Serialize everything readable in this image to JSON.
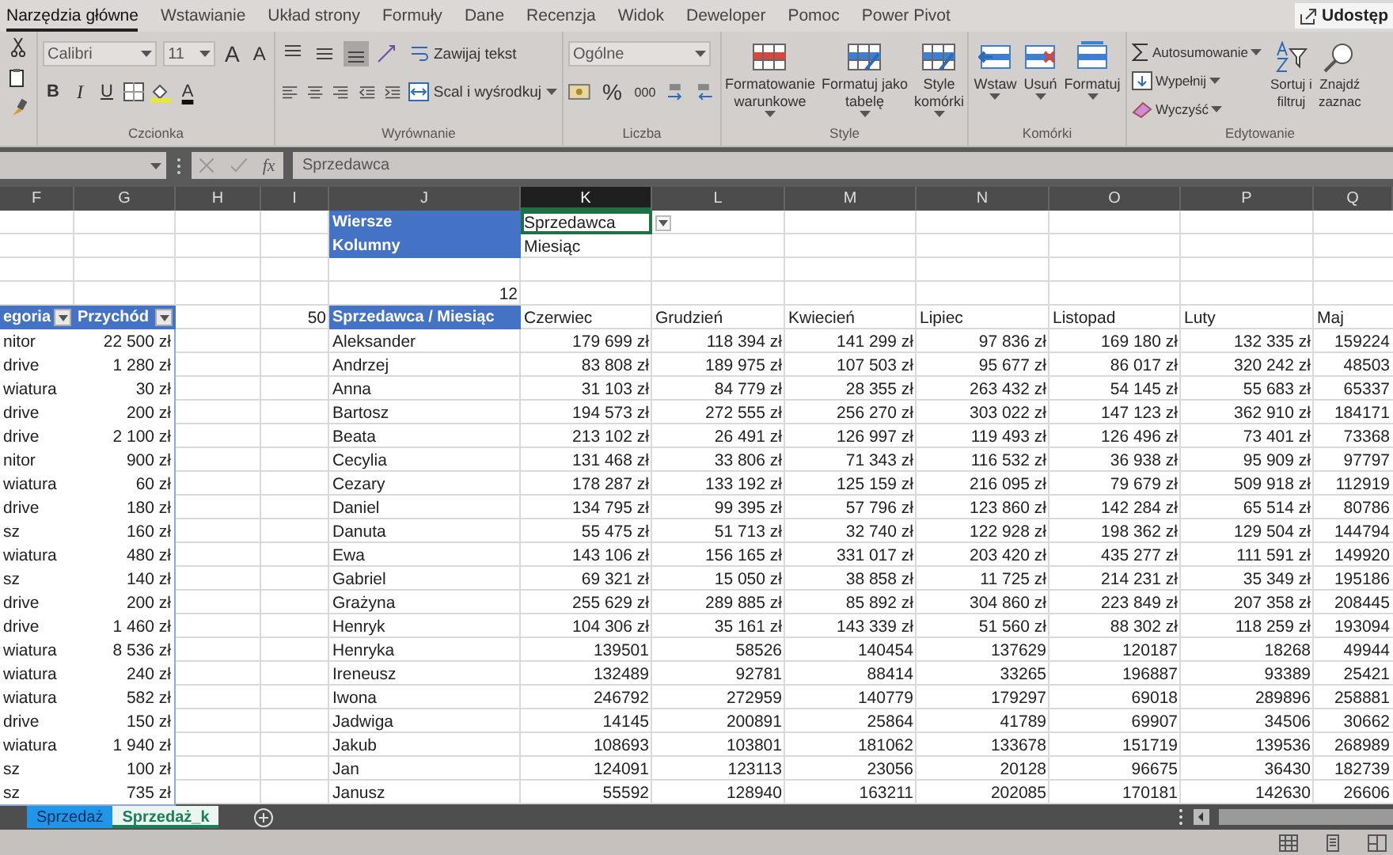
{
  "ribbon": {
    "tabs": [
      {
        "label": "Narzędzia główne",
        "selected": true
      },
      {
        "label": "Wstawianie",
        "selected": false
      },
      {
        "label": "Układ strony",
        "selected": false
      },
      {
        "label": "Formuły",
        "selected": false
      },
      {
        "label": "Dane",
        "selected": false
      },
      {
        "label": "Recenzja",
        "selected": false
      },
      {
        "label": "Widok",
        "selected": false
      },
      {
        "label": "Deweloper",
        "selected": false
      },
      {
        "label": "Pomoc",
        "selected": false
      },
      {
        "label": "Power Pivot",
        "selected": false
      }
    ],
    "share_label": "Udostęp",
    "groups": [
      {
        "kind": "clipboard"
      },
      {
        "kind": "font",
        "label": "Czcionka",
        "font_name": "Calibri",
        "font_size": "11",
        "grow": "A",
        "shrink": "A",
        "bold": "B",
        "italic": "I",
        "underline": "U",
        "font_color": "A"
      },
      {
        "kind": "alignment",
        "label": "Wyrównanie",
        "vertical_align": [
          {
            "selected": false
          },
          {
            "selected": false
          },
          {
            "selected": true
          }
        ],
        "wrap": "Zawijaj tekst",
        "merge": "Scal i wyśrodkuj"
      },
      {
        "kind": "number",
        "label": "Liczba",
        "format": "Ogólne",
        "percent": "%",
        "thousands": "000"
      },
      {
        "kind": "styles",
        "label": "Style",
        "buttons": [
          {
            "lines": [
              "Formatowanie",
              "warunkowe"
            ]
          },
          {
            "lines": [
              "Formatuj jako",
              "tabelę"
            ]
          },
          {
            "lines": [
              "Style",
              "komórki"
            ]
          }
        ]
      },
      {
        "kind": "cells",
        "label": "Komórki",
        "buttons": [
          {
            "lines": [
              "Wstaw"
            ]
          },
          {
            "lines": [
              "Usuń"
            ]
          },
          {
            "lines": [
              "Formatuj"
            ]
          }
        ]
      },
      {
        "kind": "editing",
        "label": "Edytowanie",
        "items": [
          "Autosumowanie",
          "Wypełnij",
          "Wyczyść"
        ],
        "buttons": [
          {
            "lines": [
              "Sortuj i",
              "filtruj"
            ]
          },
          {
            "lines": [
              "Znajdź",
              "zaznac"
            ]
          }
        ]
      }
    ]
  },
  "formula_bar": {
    "function_label": "fx",
    "formula": "Sprzedawca"
  },
  "sheet": {
    "columns": [
      {
        "label": "F",
        "selected": false
      },
      {
        "label": "G",
        "selected": false
      },
      {
        "label": "H",
        "selected": false
      },
      {
        "label": "I",
        "selected": false
      },
      {
        "label": "J",
        "selected": false
      },
      {
        "label": "K",
        "selected": true
      },
      {
        "label": "L",
        "selected": false
      },
      {
        "label": "M",
        "selected": false
      },
      {
        "label": "N",
        "selected": false
      },
      {
        "label": "O",
        "selected": false
      },
      {
        "label": "P",
        "selected": false
      },
      {
        "label": "Q",
        "selected": false
      }
    ],
    "pivot_fields": [
      {
        "label": "Wiersze",
        "value": "Sprzedawca",
        "selected": true
      },
      {
        "label": "Kolumny",
        "value": "Miesiąc",
        "selected": false
      }
    ],
    "month_count": "12",
    "row_count": "50",
    "source_table": {
      "headers": [
        "egoria",
        "Przychód"
      ],
      "rows": [
        [
          "nitor",
          "22 500 zł"
        ],
        [
          "drive",
          "1 280 zł"
        ],
        [
          "wiatura",
          "30 zł"
        ],
        [
          "drive",
          "200 zł"
        ],
        [
          "drive",
          "2 100 zł"
        ],
        [
          "nitor",
          "900 zł"
        ],
        [
          "wiatura",
          "60 zł"
        ],
        [
          "drive",
          "180 zł"
        ],
        [
          "sz",
          "160 zł"
        ],
        [
          "wiatura",
          "480 zł"
        ],
        [
          "sz",
          "140 zł"
        ],
        [
          "drive",
          "200 zł"
        ],
        [
          "drive",
          "1 460 zł"
        ],
        [
          "wiatura",
          "8 536 zł"
        ],
        [
          "wiatura",
          "240 zł"
        ],
        [
          "wiatura",
          "582 zł"
        ],
        [
          "drive",
          "150 zł"
        ],
        [
          "wiatura",
          "1 940 zł"
        ],
        [
          "sz",
          "100 zł"
        ],
        [
          "sz",
          "735 zł"
        ]
      ]
    },
    "pivot": {
      "corner": "Sprzedawca / Miesiąc",
      "months": [
        "Czerwiec",
        "Grudzień",
        "Kwiecień",
        "Lipiec",
        "Listopad",
        "Luty",
        "Maj"
      ],
      "rows": [
        {
          "name": "Aleksander",
          "values": [
            "179 699 zł",
            "118 394 zł",
            "141 299 zł",
            "97 836 zł",
            "169 180 zł",
            "132 335 zł",
            "159224"
          ]
        },
        {
          "name": "Andrzej",
          "values": [
            "83 808 zł",
            "189 975 zł",
            "107 503 zł",
            "95 677 zł",
            "86 017 zł",
            "320 242 zł",
            "48503"
          ]
        },
        {
          "name": "Anna",
          "values": [
            "31 103 zł",
            "84 779 zł",
            "28 355 zł",
            "263 432 zł",
            "54 145 zł",
            "55 683 zł",
            "65337"
          ]
        },
        {
          "name": "Bartosz",
          "values": [
            "194 573 zł",
            "272 555 zł",
            "256 270 zł",
            "303 022 zł",
            "147 123 zł",
            "362 910 zł",
            "184171"
          ]
        },
        {
          "name": "Beata",
          "values": [
            "213 102 zł",
            "26 491 zł",
            "126 997 zł",
            "119 493 zł",
            "126 496 zł",
            "73 401 zł",
            "73368"
          ]
        },
        {
          "name": "Cecylia",
          "values": [
            "131 468 zł",
            "33 806 zł",
            "71 343 zł",
            "116 532 zł",
            "36 938 zł",
            "95 909 zł",
            "97797"
          ]
        },
        {
          "name": "Cezary",
          "values": [
            "178 287 zł",
            "133 192 zł",
            "125 159 zł",
            "216 095 zł",
            "79 679 zł",
            "509 918 zł",
            "112919"
          ]
        },
        {
          "name": "Daniel",
          "values": [
            "134 795 zł",
            "99 395 zł",
            "57 796 zł",
            "123 860 zł",
            "142 284 zł",
            "65 514 zł",
            "80786"
          ]
        },
        {
          "name": "Danuta",
          "values": [
            "55 475 zł",
            "51 713 zł",
            "32 740 zł",
            "122 928 zł",
            "198 362 zł",
            "129 504 zł",
            "144794"
          ]
        },
        {
          "name": "Ewa",
          "values": [
            "143 106 zł",
            "156 165 zł",
            "331 017 zł",
            "203 420 zł",
            "435 277 zł",
            "111 591 zł",
            "149920"
          ]
        },
        {
          "name": "Gabriel",
          "values": [
            "69 321 zł",
            "15 050 zł",
            "38 858 zł",
            "11 725 zł",
            "214 231 zł",
            "35 349 zł",
            "195186"
          ]
        },
        {
          "name": "Grażyna",
          "values": [
            "255 629 zł",
            "289 885 zł",
            "85 892 zł",
            "304 860 zł",
            "223 849 zł",
            "207 358 zł",
            "208445"
          ]
        },
        {
          "name": "Henryk",
          "values": [
            "104 306 zł",
            "35 161 zł",
            "143 339 zł",
            "51 560 zł",
            "88 302 zł",
            "118 259 zł",
            "193094"
          ]
        },
        {
          "name": "Henryka",
          "values": [
            "139501",
            "58526",
            "140454",
            "137629",
            "120187",
            "18268",
            "49944"
          ]
        },
        {
          "name": "Ireneusz",
          "values": [
            "132489",
            "92781",
            "88414",
            "33265",
            "196887",
            "93389",
            "25421"
          ]
        },
        {
          "name": "Iwona",
          "values": [
            "246792",
            "272959",
            "140779",
            "179297",
            "69018",
            "289896",
            "258881"
          ]
        },
        {
          "name": "Jadwiga",
          "values": [
            "14145",
            "200891",
            "25864",
            "41789",
            "69907",
            "34506",
            "30662"
          ]
        },
        {
          "name": "Jakub",
          "values": [
            "108693",
            "103801",
            "181062",
            "133678",
            "151719",
            "139536",
            "268989"
          ]
        },
        {
          "name": "Jan",
          "values": [
            "124091",
            "123113",
            "23056",
            "20128",
            "96675",
            "36430",
            "182739"
          ]
        },
        {
          "name": "Janusz",
          "values": [
            "55592",
            "128940",
            "163211",
            "202085",
            "170181",
            "142630",
            "26606"
          ]
        }
      ]
    }
  },
  "sheet_tabs": [
    {
      "label": "Sprzedaż",
      "selected": false
    },
    {
      "label": "Sprzedaż_k",
      "selected": true
    }
  ]
}
